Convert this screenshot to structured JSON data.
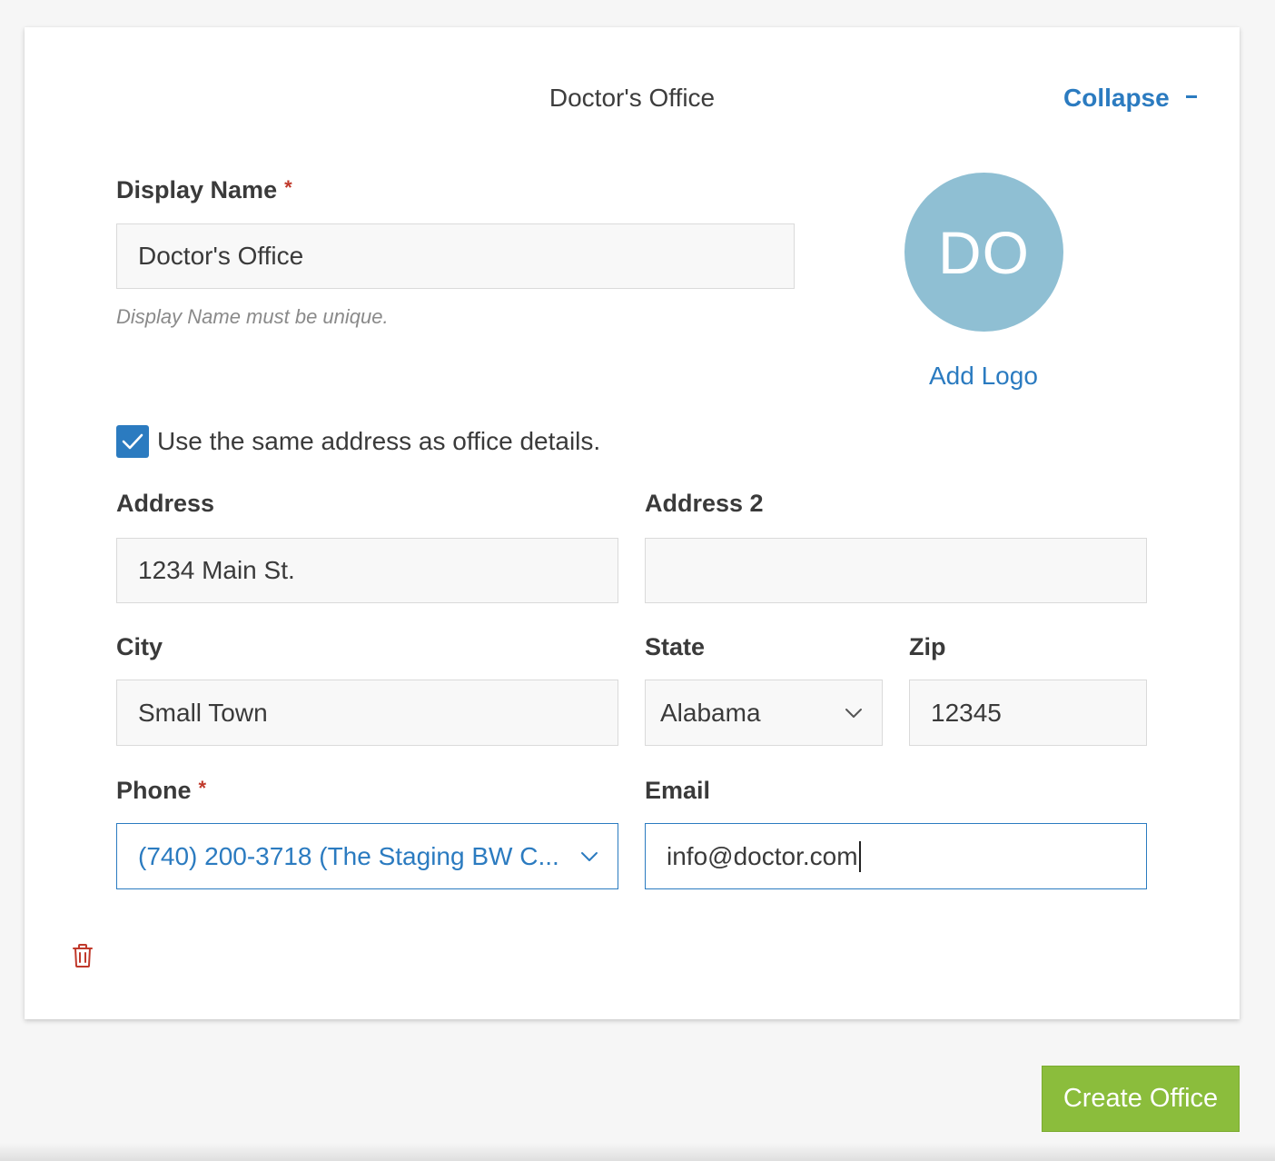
{
  "card": {
    "title": "Doctor's Office",
    "collapse_label": "Collapse"
  },
  "display_name": {
    "label": "Display Name",
    "required_mark": "*",
    "value": "Doctor's Office",
    "hint": "Display Name must be unique."
  },
  "logo": {
    "initials": "DO",
    "add_label": "Add Logo",
    "color": "#8fbfd3"
  },
  "same_address": {
    "checked": true,
    "label": "Use the same address as office details."
  },
  "address": {
    "label": "Address",
    "value": "1234 Main St."
  },
  "address2": {
    "label": "Address 2",
    "value": ""
  },
  "city": {
    "label": "City",
    "value": "Small Town"
  },
  "state": {
    "label": "State",
    "value": "Alabama"
  },
  "zip": {
    "label": "Zip",
    "value": "12345"
  },
  "phone": {
    "label": "Phone",
    "required_mark": "*",
    "value": "(740) 200-3718 (The Staging BW C..."
  },
  "email": {
    "label": "Email",
    "value": "info@doctor.com"
  },
  "actions": {
    "create_label": "Create Office",
    "create_color": "#8bbd3c",
    "delete_icon": "trash-icon"
  },
  "colors": {
    "accent": "#2b7bc0",
    "required": "#c0392b"
  }
}
